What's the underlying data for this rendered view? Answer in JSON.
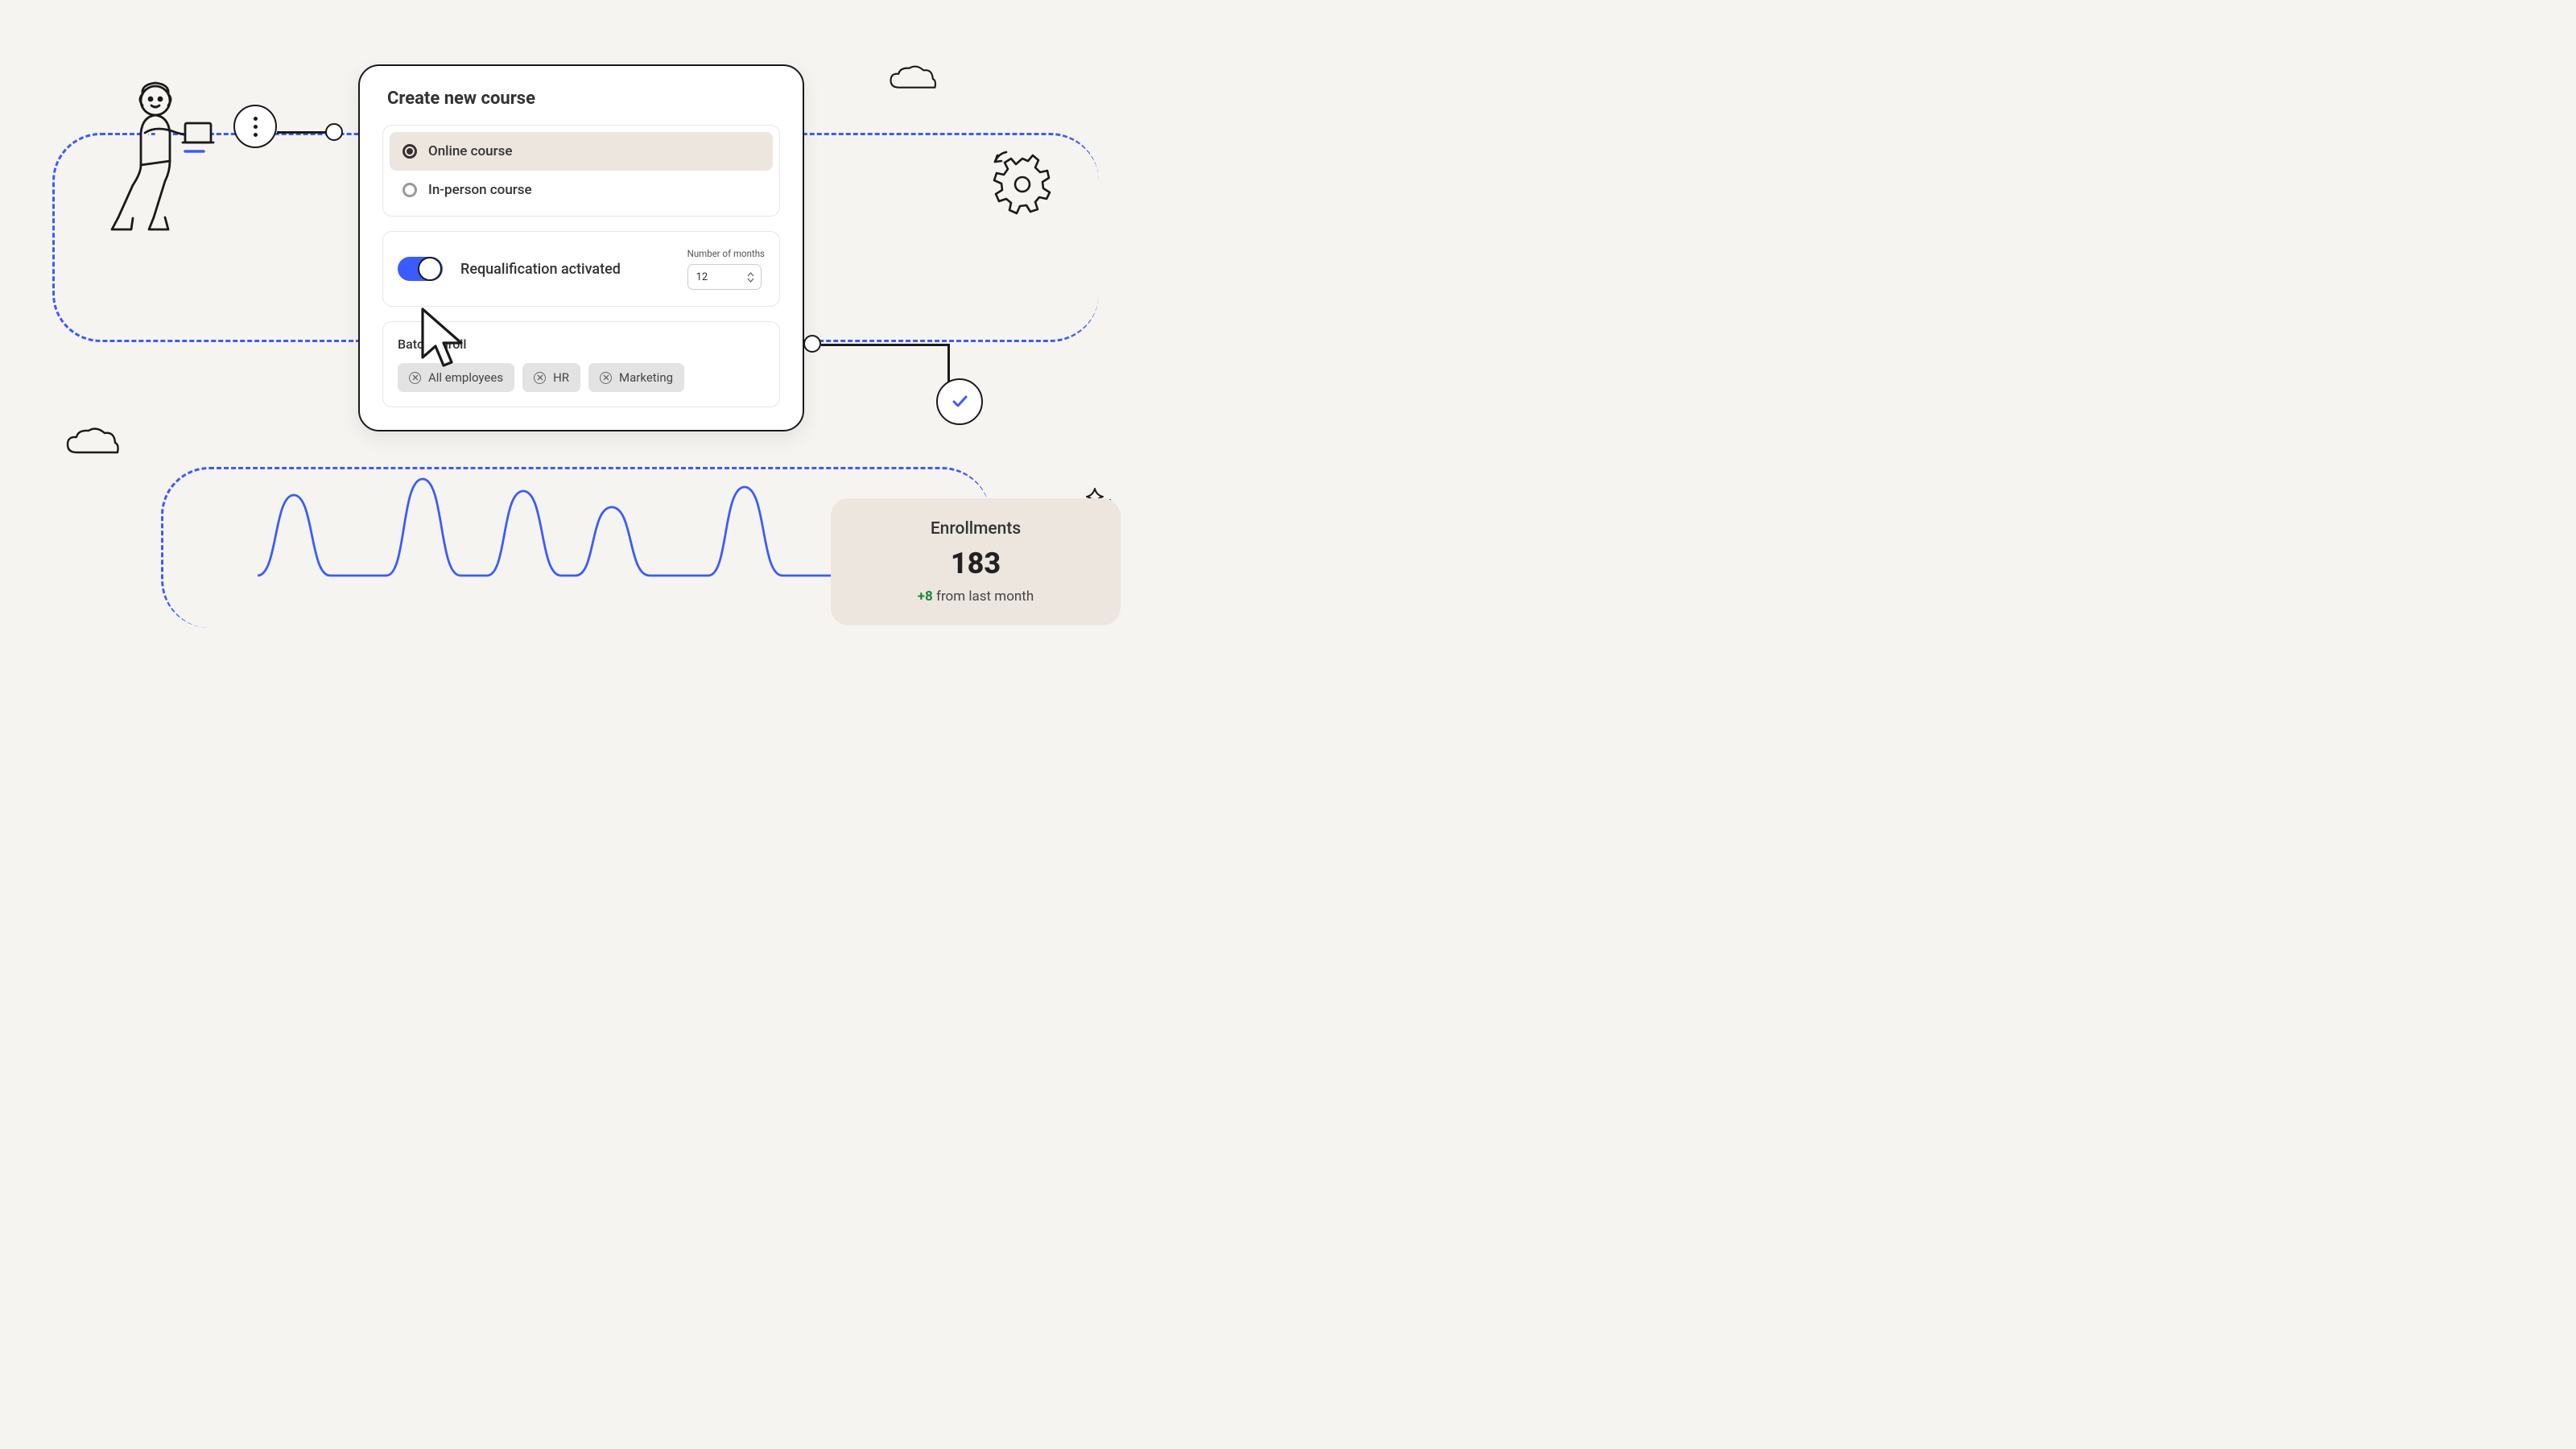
{
  "modal": {
    "title": "Create new course",
    "course_types": [
      {
        "label": "Online course",
        "selected": true
      },
      {
        "label": "In-person course",
        "selected": false
      }
    ],
    "requal": {
      "toggle_on": true,
      "label": "Requalification activated",
      "months_label": "Number of months",
      "months_value": "12"
    },
    "batch": {
      "title": "Batch enroll",
      "tags": [
        "All employees",
        "HR",
        "Marketing"
      ]
    }
  },
  "stats": {
    "title": "Enrollments",
    "value": "183",
    "delta_prefix": "+8",
    "delta_suffix": " from last month"
  },
  "icons": {
    "more": "more-vertical-icon",
    "check": "check-icon",
    "gear": "gear-icon",
    "cloud": "cloud-icon",
    "person": "person-laptop-icon",
    "cursor": "cursor-icon",
    "sparkle": "sparkle-icon"
  },
  "colors": {
    "accent": "#3a5cff",
    "bg": "#f6f4f1",
    "card_beige": "#ede6df",
    "success": "#1b8a3a"
  }
}
